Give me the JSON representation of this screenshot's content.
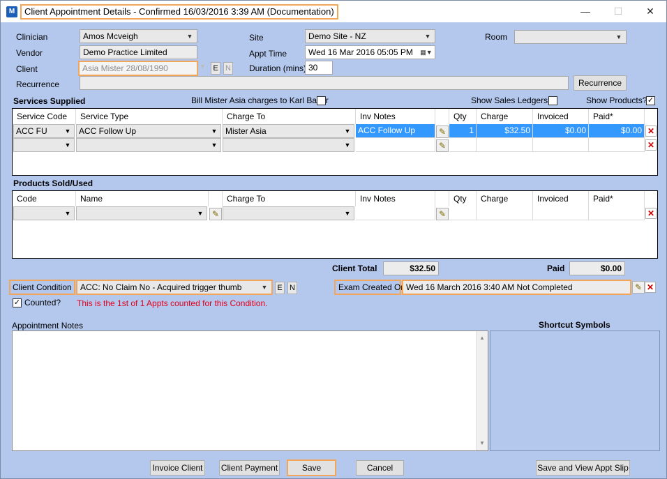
{
  "window": {
    "title": "Client Appointment Details - Confirmed 16/03/2016 3:39 AM (Documentation)",
    "icon": "M",
    "minimize": "—",
    "maximize": "☐",
    "close": "✕"
  },
  "form": {
    "clinician_label": "Clinician",
    "clinician_value": "Amos Mcveigh",
    "vendor_label": "Vendor",
    "vendor_value": "Demo Practice Limited",
    "client_label": "Client",
    "client_value": "Asia Mister 28/08/1990",
    "client_e": "E",
    "client_n": "N",
    "recurrence_label": "Recurrence",
    "recurrence_value": "",
    "recurrence_button": "Recurrence",
    "site_label": "Site",
    "site_value": "Demo Site - NZ",
    "appt_time_label": "Appt Time",
    "appt_time_value": "Wed 16 Mar 2016 05:05 PM",
    "duration_label": "Duration (mins)",
    "duration_value": "30",
    "room_label": "Room",
    "room_value": ""
  },
  "services": {
    "title": "Services Supplied",
    "bill_label": "Bill Mister Asia charges to Karl Baker",
    "show_sales_label": "Show Sales Ledgers?",
    "show_products_label": "Show Products?",
    "show_products_checked": "✓",
    "headers": [
      "Service Code",
      "Service Type",
      "Charge To",
      "Inv Notes",
      "Qty",
      "Charge",
      "Invoiced",
      "Paid*"
    ],
    "row1": {
      "code": "ACC FU",
      "type": "ACC Follow Up",
      "charge_to": "Mister Asia",
      "inv_notes": "ACC Follow Up",
      "qty": "1",
      "charge": "$32.50",
      "invoiced": "$0.00",
      "paid": "$0.00"
    }
  },
  "products": {
    "title": "Products Sold/Used",
    "headers": [
      "Code",
      "Name",
      "Charge To",
      "Inv Notes",
      "Qty",
      "Charge",
      "Invoiced",
      "Paid*"
    ]
  },
  "totals": {
    "client_total_label": "Client Total",
    "client_total_value": "$32.50",
    "paid_label": "Paid",
    "paid_value": "$0.00"
  },
  "condition": {
    "label": "Client Condition",
    "value": "ACC: No Claim No -  Acquired trigger thumb",
    "e": "E",
    "n": "N",
    "exam_label": "Exam Created On",
    "exam_value": "Wed 16 March 2016 3:40 AM Not Completed",
    "counted_label": "Counted?",
    "counted_checked": "✓",
    "counted_note": "This is the 1st of 1 Appts counted for this Condition."
  },
  "notes": {
    "appointment_label": "Appointment Notes",
    "shortcut_label": "Shortcut Symbols"
  },
  "buttons": {
    "invoice_client": "Invoice Client",
    "client_payment": "Client Payment",
    "save": "Save",
    "cancel": "Cancel",
    "save_view": "Save and View Appt Slip"
  },
  "icons": {
    "dropdown": "▼",
    "pencil": "✎",
    "delete": "✕",
    "calendar": "▦",
    "scroll_up": "▲",
    "scroll_down": "▼"
  }
}
